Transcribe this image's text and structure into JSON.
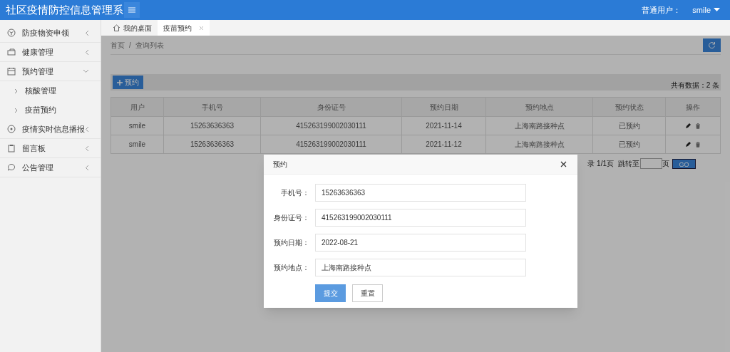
{
  "header": {
    "title": "社区疫情防控信息管理系",
    "user_label": "普通用户：",
    "user_name": "smile"
  },
  "sidebar": {
    "items": [
      {
        "label": "防疫物资申领",
        "expanded": false
      },
      {
        "label": "健康管理",
        "expanded": false
      },
      {
        "label": "预约管理",
        "expanded": true,
        "children": [
          {
            "label": "核酸管理"
          },
          {
            "label": "疫苗预约"
          }
        ]
      },
      {
        "label": "疫情实时信息播报",
        "expanded": false
      },
      {
        "label": "留言板",
        "expanded": false
      },
      {
        "label": "公告管理",
        "expanded": false
      }
    ]
  },
  "tabs": [
    {
      "label": "我的桌面",
      "selected": false,
      "kind": "home"
    },
    {
      "label": "疫苗预约",
      "selected": true,
      "kind": "closable"
    }
  ],
  "breadcrumb": {
    "items": [
      "首页",
      "查询列表"
    ],
    "separator": "/"
  },
  "toolbar": {
    "add_button": "预约",
    "total": "共有数据：2 条"
  },
  "table": {
    "columns": [
      "用户",
      "手机号",
      "身份证号",
      "预约日期",
      "预约地点",
      "预约状态",
      "操作"
    ],
    "rows": [
      {
        "cells": [
          "smile",
          "15263636363",
          "415263199002030111",
          "2021-11-14",
          "上海南路接种点",
          "已预约"
        ]
      },
      {
        "cells": [
          "smile",
          "15263636363",
          "415263199002030111",
          "2021-11-12",
          "上海南路接种点",
          "已预约"
        ]
      }
    ]
  },
  "pager": {
    "info": "录 1/1页",
    "jump_label": "跳转至",
    "page_suffix": "页",
    "go": "GO"
  },
  "modal": {
    "title": "预约",
    "fields": [
      {
        "label": "手机号：",
        "value": "15263636363"
      },
      {
        "label": "身份证号：",
        "value": "415263199002030111"
      },
      {
        "label": "预约日期：",
        "value": "2022-08-21"
      },
      {
        "label": "预约地点：",
        "value": "上海南路接种点"
      }
    ],
    "buttons": [
      {
        "label": "提交",
        "kind": "primary"
      },
      {
        "label": "重置",
        "kind": "default"
      }
    ]
  }
}
